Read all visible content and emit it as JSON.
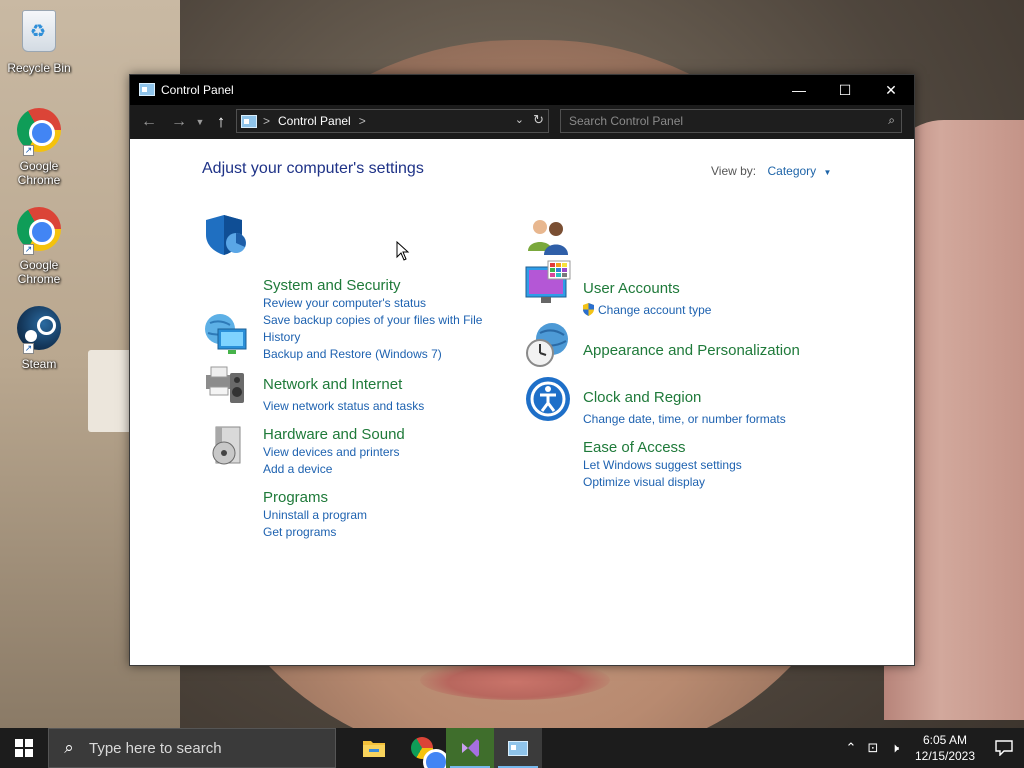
{
  "desktop": {
    "icons": [
      {
        "label": "Recycle Bin",
        "icon": "recycle-bin-icon"
      },
      {
        "label": "Google Chrome",
        "icon": "chrome-icon"
      },
      {
        "label": "Google Chrome",
        "icon": "chrome-icon"
      },
      {
        "label": "Steam",
        "icon": "steam-icon"
      }
    ]
  },
  "window": {
    "title": "Control Panel",
    "address": {
      "segment": "Control Panel",
      "separator": ">"
    },
    "search": {
      "placeholder": "Search Control Panel"
    },
    "controls": {
      "minimize": "—",
      "maximize": "☐",
      "close": "✕"
    }
  },
  "content": {
    "heading": "Adjust your computer's settings",
    "view_by": {
      "label": "View by:",
      "value": "Category"
    },
    "left_categories": [
      {
        "title": "System and Security",
        "icon": "shield-icon",
        "links": [
          "Review your computer's status",
          "Save backup copies of your files with File History",
          "Backup and Restore (Windows 7)"
        ]
      },
      {
        "title": "Network and Internet",
        "icon": "network-globe-icon",
        "links": [
          "View network status and tasks"
        ]
      },
      {
        "title": "Hardware and Sound",
        "icon": "printer-speaker-icon",
        "links": [
          "View devices and printers",
          "Add a device"
        ]
      },
      {
        "title": "Programs",
        "icon": "programs-disc-icon",
        "links": [
          "Uninstall a program",
          "Get programs"
        ]
      }
    ],
    "right_categories": [
      {
        "title": "User Accounts",
        "icon": "users-icon",
        "links": [
          "Change account type"
        ]
      },
      {
        "title": "Appearance and Personalization",
        "icon": "monitor-palette-icon",
        "links": []
      },
      {
        "title": "Clock and Region",
        "icon": "clock-globe-icon",
        "links": [
          "Change date, time, or number formats"
        ]
      },
      {
        "title": "Ease of Access",
        "icon": "ease-of-access-icon",
        "links": [
          "Let Windows suggest settings",
          "Optimize visual display"
        ]
      }
    ]
  },
  "taskbar": {
    "search_placeholder": "Type here to search",
    "apps": [
      "file-explorer-icon",
      "chrome-icon",
      "visual-studio-icon",
      "control-panel-icon"
    ],
    "time": "6:05 AM",
    "date": "12/15/2023"
  }
}
